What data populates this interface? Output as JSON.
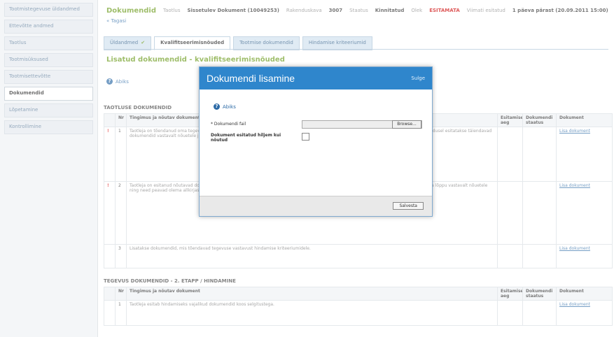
{
  "sidebar": {
    "items": [
      {
        "label": "Tootmistegevuse üldandmed"
      },
      {
        "label": "Ettevõtte andmed"
      },
      {
        "label": "Taotlus"
      },
      {
        "label": "Tootmisüksused"
      },
      {
        "label": "Tootmisettevõtte"
      },
      {
        "label": "Dokumendid"
      },
      {
        "label": "Lõpetamine"
      },
      {
        "label": "Kontrollimine"
      }
    ]
  },
  "header": {
    "title": "Dokumendid",
    "fields": [
      {
        "label": "Taotlus",
        "value": "Sissetulev Dokument (10049253)"
      },
      {
        "label": "Rakenduskava",
        "value": "3007"
      },
      {
        "label": "Staatus",
        "value": "Kinnitatud"
      },
      {
        "label": "Olek",
        "value": "ESITAMATA",
        "highlight": true
      },
      {
        "label": "Viimati esitatud",
        "value": "1 päeva pärast (20.09.2011 15:00)"
      }
    ],
    "back_link": "« Tagasi"
  },
  "tabs": [
    {
      "label": "Üldandmed",
      "check": "✔"
    },
    {
      "label": "Kvalifitseerimisnõuded"
    },
    {
      "label": "Tootmise dokumendid"
    },
    {
      "label": "Hindamise kriteeriumid"
    }
  ],
  "section_title": "Lisatud dokumendid - kvalifitseerimisnõuded",
  "help_label": "Abiks",
  "subhead_top": "TAOTLUSE DOKUMENDID",
  "subhead_bottom": "TEGEVUS DOKUMENDID - 2. ETAPP / HINDAMINE",
  "table_headers": {
    "nr": "Nr",
    "name": "Tingimus ja nõutav dokument",
    "date": "Esitamise aeg",
    "status": "Dokumendi staatus",
    "doc": "Dokument"
  },
  "rows_top": [
    {
      "nr": "1",
      "flag": "!",
      "text": "Taotleja on tõendanud oma tegevust ja vastab tingimustele, mis on esitatud taotlusvormil ning kinnitab, et kõik esitatud andmed on õiged. Vajadusel esitatakse täiendavad dokumendid vastavalt nõuetele ja tähtaegadele.",
      "doc": "Lisa dokument"
    },
    {
      "nr": "2",
      "flag": "!",
      "text": "Taotleja on esitanud nõutavad dokumendid ning kinnitab, et tegevus vastab rakenduskava tingimustele. Dokumendid tuleb esitada enne tähtaja lõppu vastavalt nõuetele ning need peavad olema allkirjastatud.",
      "doc": "Lisa dokument"
    },
    {
      "nr": "3",
      "flag": "",
      "text": "Lisatakse dokumendid, mis tõendavad tegevuse vastavust hindamise kriteeriumidele.",
      "doc": "Lisa dokument"
    }
  ],
  "rows_bottom": [
    {
      "nr": "1",
      "flag": "",
      "text": "Taotleja esitab hindamiseks vajalikud dokumendid koos selgitustega.",
      "doc": "Lisa dokument"
    }
  ],
  "dialog": {
    "title": "Dokumendi lisamine",
    "close_label": "Sulge",
    "help_label": "Abiks",
    "file_label": "* Dokumendi fail",
    "browse_label": "Browse...",
    "checkbox_label": "Dokument esitatud hiljem kui nõutud",
    "save_label": "Salvesta"
  },
  "colors": {
    "accent": "#2f86cc",
    "green": "#6a9a1a",
    "alert": "#cc0000"
  }
}
